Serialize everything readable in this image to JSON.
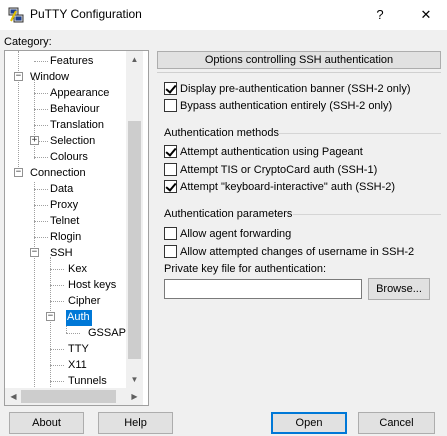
{
  "window": {
    "title": "PuTTY Configuration",
    "help_glyph": "?",
    "close_glyph": "✕"
  },
  "category_label": "Category:",
  "tree": [
    {
      "label": "Features"
    },
    {
      "label": "Window"
    },
    {
      "label": "Appearance"
    },
    {
      "label": "Behaviour"
    },
    {
      "label": "Translation"
    },
    {
      "label": "Selection"
    },
    {
      "label": "Colours"
    },
    {
      "label": "Connection"
    },
    {
      "label": "Data"
    },
    {
      "label": "Proxy"
    },
    {
      "label": "Telnet"
    },
    {
      "label": "Rlogin"
    },
    {
      "label": "SSH"
    },
    {
      "label": "Kex"
    },
    {
      "label": "Host keys"
    },
    {
      "label": "Cipher"
    },
    {
      "label": "Auth",
      "selected": true
    },
    {
      "label": "GSSAPI"
    },
    {
      "label": "TTY"
    },
    {
      "label": "X11"
    },
    {
      "label": "Tunnels"
    }
  ],
  "panel": {
    "header": "Options controlling SSH authentication",
    "banner": [
      {
        "label": "Display pre-authentication banner (SSH-2 only)",
        "checked": true
      },
      {
        "label": "Bypass authentication entirely (SSH-2 only)",
        "checked": false
      }
    ],
    "methods_title": "Authentication methods",
    "methods": [
      {
        "label": "Attempt authentication using Pageant",
        "checked": true
      },
      {
        "label": "Attempt TIS or CryptoCard auth (SSH-1)",
        "checked": false
      },
      {
        "label": "Attempt \"keyboard-interactive\" auth (SSH-2)",
        "checked": true
      }
    ],
    "params_title": "Authentication parameters",
    "params": [
      {
        "label": "Allow agent forwarding",
        "checked": false
      },
      {
        "label": "Allow attempted changes of username in SSH-2",
        "checked": false
      }
    ],
    "keyfile_label": "Private key file for authentication:",
    "keyfile_value": "",
    "browse_label": "Browse..."
  },
  "buttons": {
    "about": "About",
    "help": "Help",
    "open": "Open",
    "cancel": "Cancel"
  },
  "colors": {
    "selection": "#0078d7",
    "default_button_border": "#0078d7"
  }
}
